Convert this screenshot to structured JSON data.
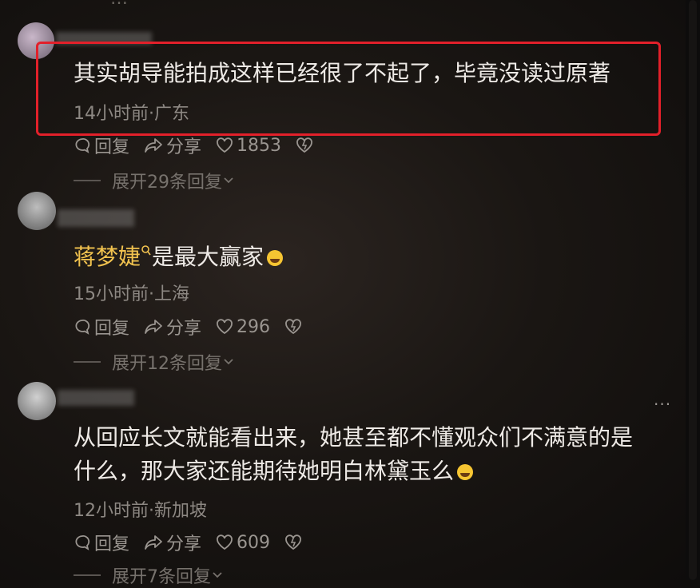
{
  "comments": [
    {
      "text": "其实胡导能拍成这样已经很了不起了，毕竟没读过原著",
      "meta": "14小时前·广东",
      "reply": "回复",
      "share": "分享",
      "likes": "1853",
      "expand": "展开29条回复"
    },
    {
      "username": "蒋梦婕",
      "text": "是最大赢家",
      "meta": "15小时前·上海",
      "reply": "回复",
      "share": "分享",
      "likes": "296",
      "expand": "展开12条回复"
    },
    {
      "text_line1": "从回应长文就能看出来，她甚至都不懂观众们不满意的是",
      "text_line2": "什么，那大家还能期待她明白林黛玉么",
      "meta": "12小时前·新加坡",
      "reply": "回复",
      "share": "分享",
      "likes": "609",
      "expand": "展开7条回复"
    }
  ],
  "colors": {
    "highlight_box": "#e2202a",
    "username_gold": "#f2c34f"
  },
  "icons": [
    "reply-icon",
    "share-icon",
    "heart-icon",
    "dislike-heart-icon",
    "search-icon",
    "more-icon"
  ]
}
